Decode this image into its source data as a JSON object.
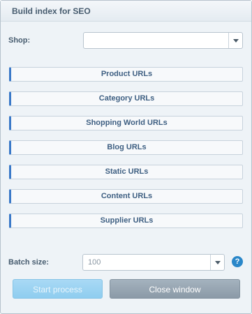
{
  "window": {
    "title": "Build index for SEO"
  },
  "shop": {
    "label": "Shop:",
    "value": ""
  },
  "url_buttons": [
    "Product URLs",
    "Category URLs",
    "Shopping World URLs",
    "Blog URLs",
    "Static URLs",
    "Content URLs",
    "Supplier URLs"
  ],
  "batch": {
    "label": "Batch size:",
    "value": "100"
  },
  "help_icon": {
    "glyph": "?",
    "icon": "help-icon"
  },
  "buttons": {
    "start": "Start process",
    "close": "Close window"
  },
  "colors": {
    "accent": "#3a79c8",
    "help": "#2a87c9",
    "start_button": "#9fd4f3",
    "close_button": "#97a6b3"
  }
}
